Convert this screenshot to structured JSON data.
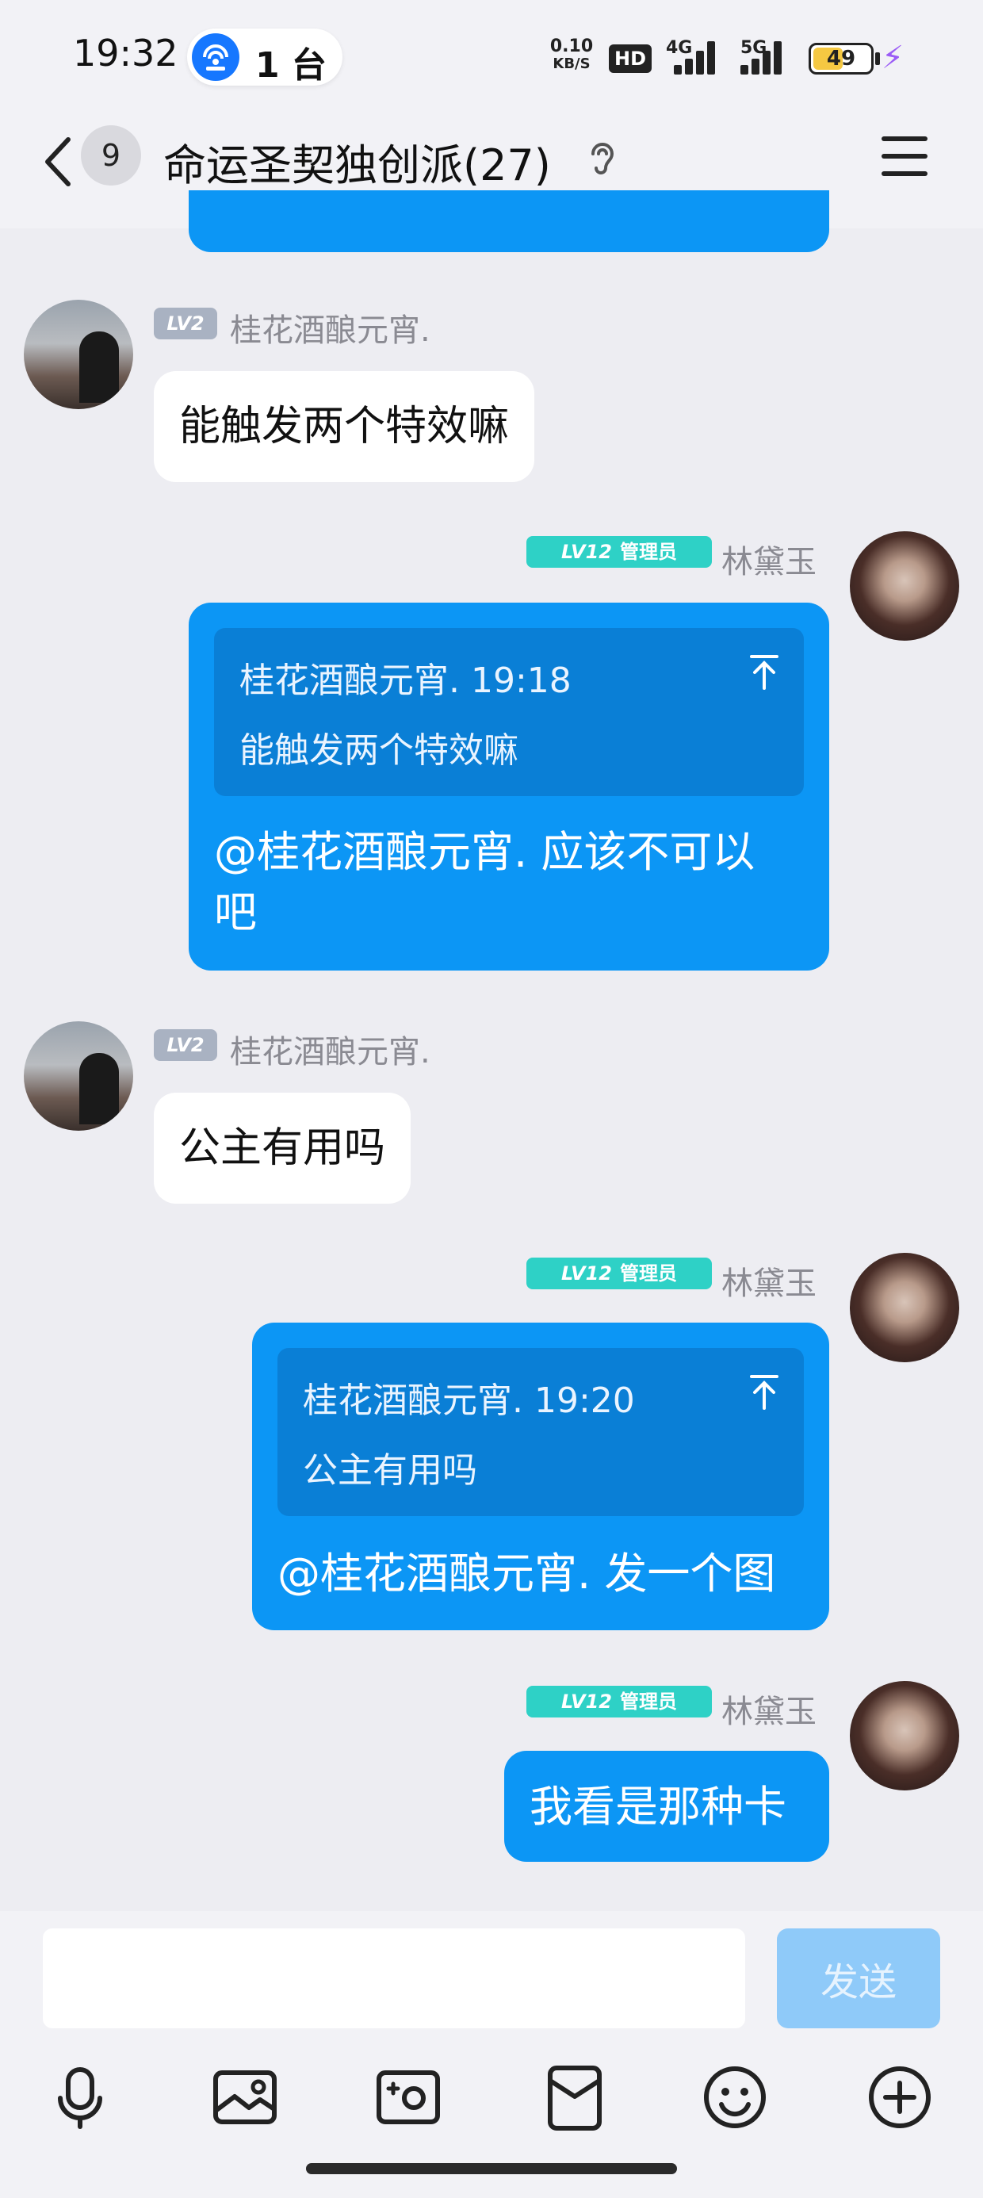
{
  "status_bar": {
    "time": "19:32",
    "hotspot_label": "1 台",
    "net_speed_value": "0.10",
    "net_speed_unit": "KB/S",
    "hd_label": "HD",
    "signal_1_label": "4G",
    "signal_2_label": "5G",
    "battery_level": "49",
    "battery_fraction": 0.49
  },
  "header": {
    "unread_count": "9",
    "title": "命运圣契独创派(27)"
  },
  "messages": [
    {
      "side": "left",
      "level": "LV2",
      "sender": "桂花酒酿元宵.",
      "text": "能触发两个特效嘛"
    },
    {
      "side": "right",
      "level": "LV12",
      "role": "管理员",
      "sender": "林黛玉",
      "quote_head": "桂花酒酿元宵. 19:18",
      "quote_body": "能触发两个特效嘛",
      "text_line1": "@桂花酒酿元宵. 应该不可以",
      "text_line2": "吧"
    },
    {
      "side": "left",
      "level": "LV2",
      "sender": "桂花酒酿元宵.",
      "text": "公主有用吗"
    },
    {
      "side": "right",
      "level": "LV12",
      "role": "管理员",
      "sender": "林黛玉",
      "quote_head": "桂花酒酿元宵. 19:20",
      "quote_body": "公主有用吗",
      "text_line1": "@桂花酒酿元宵. 发一个图"
    },
    {
      "side": "right",
      "level": "LV12",
      "role": "管理员",
      "sender": "林黛玉",
      "text": "我看是那种卡"
    }
  ],
  "input_bar": {
    "placeholder": "",
    "send_label": "发送"
  },
  "toolbar_icons": [
    "microphone-icon",
    "image-icon",
    "camera-icon",
    "red-packet-icon",
    "emoji-icon",
    "plus-icon"
  ],
  "colors": {
    "accent_blue": "#0c96f5",
    "quote_blue": "#0a7fd6",
    "teal_badge": "#2ed1c6",
    "gray_badge": "#a9b2c2",
    "background": "#ededf2"
  }
}
